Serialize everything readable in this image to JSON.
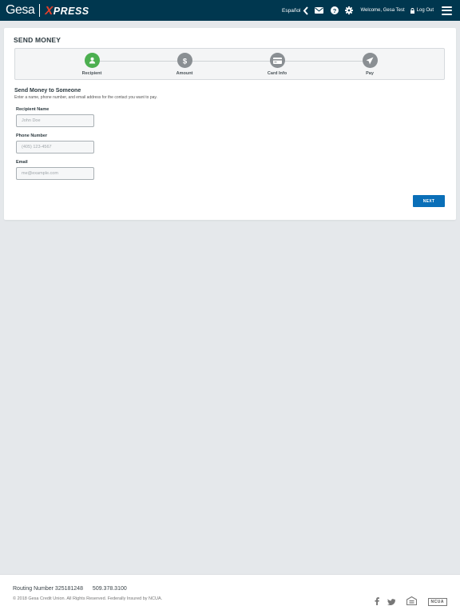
{
  "header": {
    "logo_brand": "Gesa",
    "logo_x": "X",
    "logo_product": "PRESS",
    "language_link": "Español",
    "welcome": "Welcome, Gesa Test",
    "logout": "Log Out"
  },
  "card": {
    "title": "SEND MONEY",
    "steps": [
      {
        "label": "Recipient",
        "icon": "user-icon",
        "active": true
      },
      {
        "label": "Amount",
        "icon": "dollar-icon",
        "active": false
      },
      {
        "label": "Card Info",
        "icon": "credit-card-icon",
        "active": false
      },
      {
        "label": "Pay",
        "icon": "paper-plane-icon",
        "active": false
      }
    ],
    "section_title": "Send Money to Someone",
    "section_desc": "Enter a name, phone number, and email address for the contact you want to pay.",
    "fields": {
      "recipient_name": {
        "label": "Recipient Name",
        "placeholder": "John Doe",
        "value": ""
      },
      "phone_number": {
        "label": "Phone Number",
        "placeholder": "(405) 123-4567",
        "value": ""
      },
      "email": {
        "label": "Email",
        "placeholder": "me@example.com",
        "value": ""
      }
    },
    "next_label": "NEXT"
  },
  "footer": {
    "routing_label": "Routing Number",
    "routing_number": "325181248",
    "phone": "509.378.3100",
    "copyright": "© 2018 Gesa Credit Union. All Rights Reserved. Federally Insured by NCUA.",
    "ncua_badge": "NCUA"
  },
  "colors": {
    "header_bg": "#00374f",
    "active_step": "#4caf50",
    "inactive_step": "#8a8f93",
    "primary_button": "#0a6fb8",
    "logo_accent": "#e2402c"
  }
}
